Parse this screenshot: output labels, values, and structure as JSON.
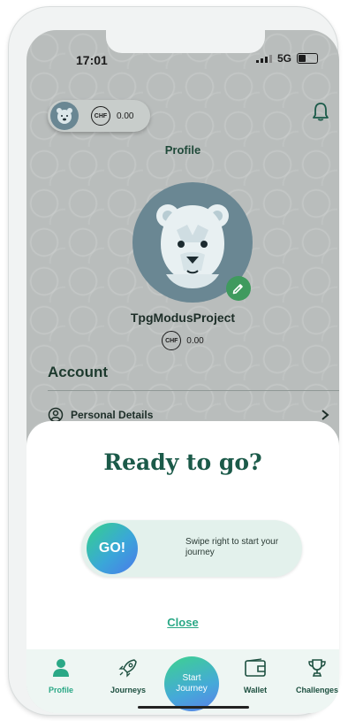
{
  "status": {
    "time": "17:01",
    "network": "5G"
  },
  "header": {
    "balance": "0.00",
    "currency": "CHF"
  },
  "profile": {
    "title": "Profile",
    "username": "TpgModusProject",
    "currency": "CHF",
    "balance": "0.00"
  },
  "account": {
    "heading": "Account",
    "items": [
      {
        "label": "Personal Details"
      }
    ]
  },
  "sheet": {
    "title": "Ready to go?",
    "go_label": "GO!",
    "swipe_hint": "Swipe right to start your journey",
    "close_label": "Close"
  },
  "nav": {
    "items": [
      {
        "label": "Profile",
        "icon": "person-icon",
        "active": true
      },
      {
        "label": "Journeys",
        "icon": "rocket-icon",
        "active": false
      },
      {
        "label": "Wallet",
        "icon": "wallet-icon",
        "active": false
      },
      {
        "label": "Challenges",
        "icon": "trophy-icon",
        "active": false
      }
    ],
    "start_label": "Start Journey"
  },
  "colors": {
    "accent": "#2aa886",
    "dark_green": "#1b5a49",
    "edit_green": "#3f9a5e"
  }
}
